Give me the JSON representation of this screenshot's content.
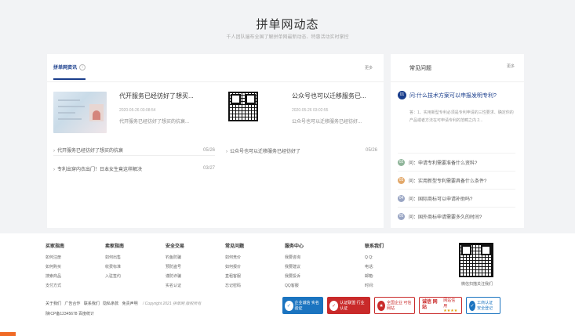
{
  "hero": {
    "title": "拼单网动态",
    "subtitle": "千人团队遍布全国了解拼单网最新动态、特惠活动实时掌控"
  },
  "news": {
    "tab_label": "拼单网资讯",
    "more_label": "更多",
    "featured": [
      {
        "title": "代开服务已经彷好了想买...",
        "date": "2020-05-26 03:08:54",
        "desc": "代开服务已经彷好了想买的抗衰...",
        "thumb": "id-card-photo"
      },
      {
        "title": "公众号也可以迁移服务已...",
        "date": "2020-05-26 03:02:55",
        "desc": "公众号也可以迁移服务已经彷好...",
        "thumb": "qr-code"
      }
    ],
    "list": [
      {
        "title": "代开服务已经彷好了想买的抗衰",
        "date": "05/26"
      },
      {
        "title": "公众号也可以迁移服务已经彷好了",
        "date": "05/26"
      },
      {
        "title": "专利出穿内衣出门！日本女生竟这样解决",
        "date": "03/27"
      }
    ]
  },
  "faq": {
    "title": "常见问题",
    "more_label": "更多",
    "top": {
      "num": "01",
      "question": "问:什么技术方案可以申报发明专利?",
      "answer": "答：1、实用新型专利必须是专利申请的三性要求、确定你的产品或者方法在可申请专利的范畴之内 2..."
    },
    "items": [
      {
        "num": "02",
        "question": "问：申请专利需要准备什么资料?"
      },
      {
        "num": "03",
        "question": "问：实用新型专利需要具备什么条件?"
      },
      {
        "num": "04",
        "question": "问：国际商标可以申请补助吗?"
      },
      {
        "num": "05",
        "question": "问：国外商标申请需要多久的时间?"
      }
    ]
  },
  "footer": {
    "columns": [
      {
        "title": "买家指南",
        "links": [
          "如何注册",
          "如何购买",
          "搜索商品",
          "支付方式"
        ]
      },
      {
        "title": "卖家指南",
        "links": [
          "如何出售",
          "收费标准",
          "入驻签约"
        ]
      },
      {
        "title": "安全交易",
        "links": [
          "钓鱼防骗",
          "预防盗号",
          "谨防诈骗",
          "实名认证"
        ]
      },
      {
        "title": "常见问题",
        "links": [
          "如何竞价",
          "如何报价",
          "直租客服",
          "忘记密码"
        ]
      },
      {
        "title": "服务中心",
        "links": [
          "我要咨询",
          "我要建议",
          "我要投诉",
          "QQ客服"
        ]
      }
    ],
    "contact": {
      "title": "联系我们",
      "qq": "Q Q:",
      "phone": "电话:",
      "email": "邮箱:",
      "hours": "时间:"
    },
    "qr_caption": "微信扫描关注我们",
    "links": [
      "关于我们",
      "广告合作",
      "联系我们",
      "隐私条款",
      "免责声明"
    ],
    "copyright": "/ Copyright 2021 拼单网 版权所有",
    "icp": "陕ICP备12345678 百度统计",
    "badges": [
      {
        "icon": "shield-icon",
        "text": "企业诚信 实名验证"
      },
      {
        "icon": "shield-icon",
        "text": "认证联盟 行业认证"
      },
      {
        "icon": "credit-icon",
        "text": "全国企业 可信网站"
      },
      {
        "icon": "seal-icon",
        "seal": "诚信 网站",
        "text": "网站信用",
        "stars": "★★★★"
      },
      {
        "icon": "shield-icon",
        "text": "工商认证 安全登记"
      }
    ]
  }
}
